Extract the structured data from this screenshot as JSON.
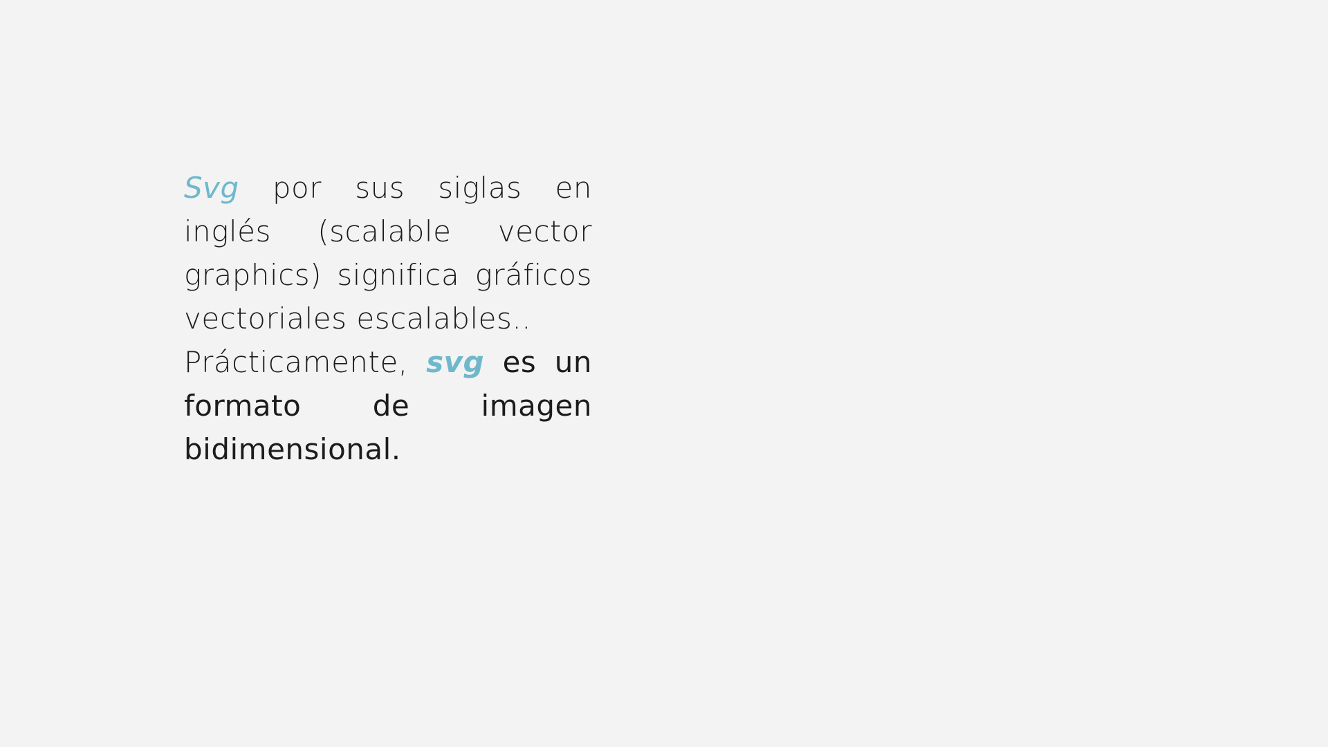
{
  "colors": {
    "background": "#f2f3f2",
    "text": "#1c1c1c",
    "accent": "#6fb8cc"
  },
  "paragraph_1": {
    "accent_word": "Svg",
    "rest": " por sus siglas en inglés (scalable vector graphics) significa gráficos vectoriales escalables.."
  },
  "paragraph_2": {
    "lead": "Prácticamente, ",
    "accent_word": "svg",
    "rest": " es un formato de imagen bidimensional."
  }
}
